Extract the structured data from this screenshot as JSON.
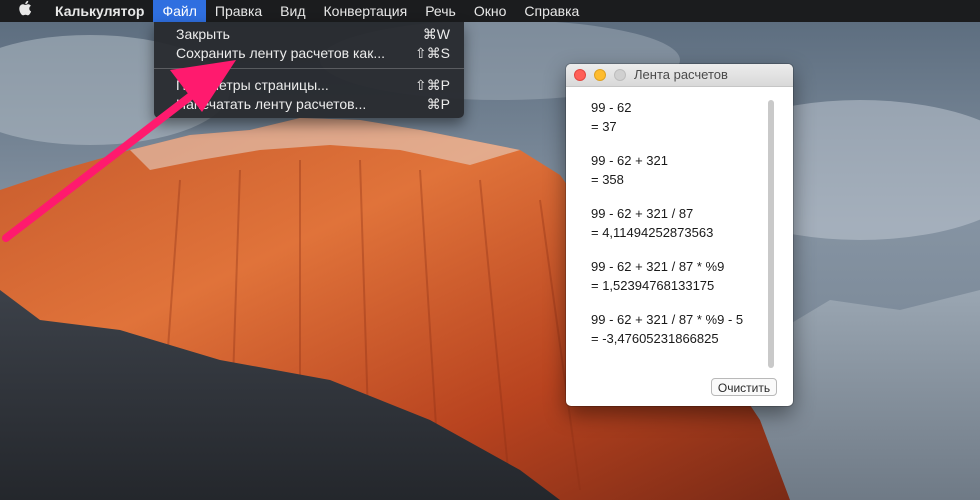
{
  "menubar": {
    "apple_icon": "apple-logo",
    "app_name": "Калькулятор",
    "items": [
      "Файл",
      "Правка",
      "Вид",
      "Конвертация",
      "Речь",
      "Окно",
      "Справка"
    ],
    "active_item": "Файл"
  },
  "file_menu": {
    "items": [
      {
        "label": "Закрыть",
        "shortcut": "⌘W"
      },
      {
        "label": "Сохранить ленту расчетов как...",
        "shortcut": "⇧⌘S"
      },
      {
        "label": "Параметры страницы...",
        "shortcut": "⇧⌘P"
      },
      {
        "label": "Напечатать ленту расчетов...",
        "shortcut": "⌘P"
      }
    ]
  },
  "tape_window": {
    "title": "Лента расчетов",
    "entries": [
      {
        "expr": "99 - 62",
        "result": "= 37"
      },
      {
        "expr": "99 - 62 + 321",
        "result": "= 358"
      },
      {
        "expr": "99 - 62 + 321 / 87",
        "result": "= 4,11494252873563"
      },
      {
        "expr": "99 - 62 + 321 / 87 * %9",
        "result": "= 1,52394768133175"
      },
      {
        "expr": "99 - 62 + 321 / 87 * %9 - 5",
        "result": "= -3,47605231866825"
      }
    ],
    "clear_button": "Очистить"
  },
  "annotation": {
    "arrow_color": "#ff1a6e"
  },
  "colors": {
    "menu_highlight": "#2f6fe0",
    "menubar_bg": "#1b1c1e"
  }
}
